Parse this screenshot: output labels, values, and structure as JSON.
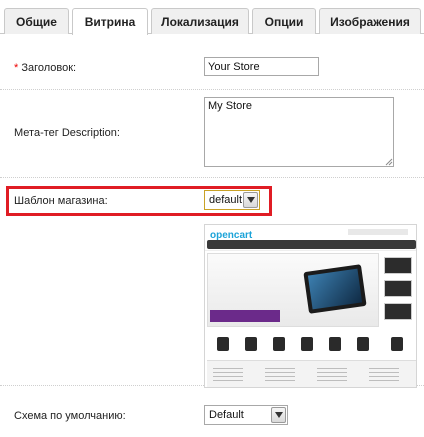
{
  "tabs": [
    {
      "label": "Общие",
      "active": false
    },
    {
      "label": "Витрина",
      "active": true
    },
    {
      "label": "Локализация",
      "active": false
    },
    {
      "label": "Опции",
      "active": false
    },
    {
      "label": "Изображения",
      "active": false
    }
  ],
  "form": {
    "title": {
      "required_mark": "*",
      "label": "Заголовок:",
      "value": "Your Store"
    },
    "meta_description": {
      "label": "Мета-тег Description:",
      "value": "My Store"
    },
    "template": {
      "label": "Шаблон магазина:",
      "selected": "default"
    },
    "preview": {
      "logo_text": "opencart"
    },
    "scheme": {
      "label": "Схема по умолчанию:",
      "selected": "Default"
    }
  },
  "colors": {
    "highlight": "#e01c24",
    "active_tab": "#ffffff",
    "inactive_tab": "#f0f0f0"
  }
}
